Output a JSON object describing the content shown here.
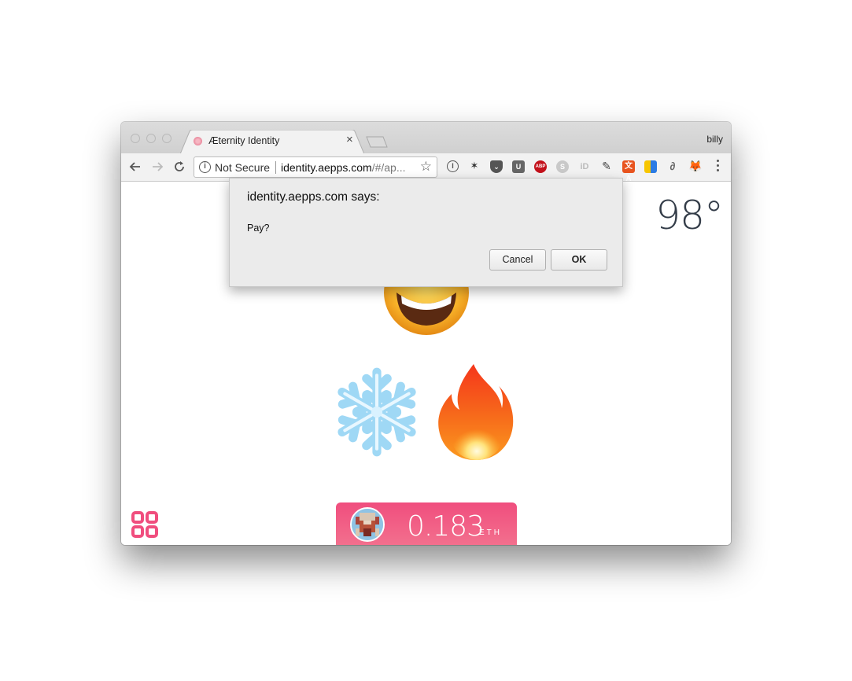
{
  "browser": {
    "tab_title": "Æternity Identity",
    "tab_close": "×",
    "profile_name": "billy",
    "security_label": "Not Secure",
    "url_host": "identity.aepps.com",
    "url_rest": "/#/ap...",
    "extensions": [
      "1password-icon",
      "dots-icon",
      "pocket-icon",
      "bitwarden-icon",
      "adblock-icon",
      "skype-icon",
      "id-icon",
      "evernote-icon",
      "translate-icon",
      "bookmark-icon",
      "ghost-icon",
      "metamask-icon"
    ]
  },
  "page": {
    "temperature": "98°",
    "balance_value": "0.183",
    "balance_currency": "ETH",
    "emojis": [
      "grinning-face-icon",
      "snowflake-icon",
      "fire-icon"
    ]
  },
  "dialog": {
    "title": "identity.aepps.com says:",
    "message": "Pay?",
    "cancel_label": "Cancel",
    "ok_label": "OK"
  },
  "colors": {
    "accent_pink": "#f04e7e",
    "temperature_text": "#333c48"
  }
}
